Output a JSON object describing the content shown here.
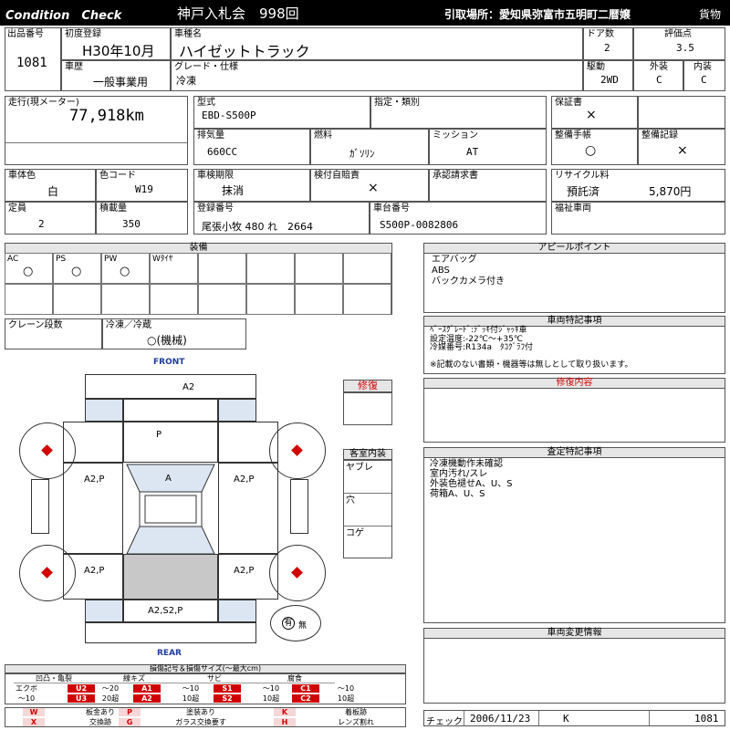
{
  "header": {
    "title_en": "Condition　Check",
    "auction": "神戸入札会　998回",
    "pickup": "引取場所：愛知県弥富市五明町二暦嬢",
    "category": "貨物"
  },
  "row1": {
    "lot_label": "出品番号",
    "lot": "1081",
    "reg_label": "初度登録",
    "reg": "H30年10月",
    "name_label": "車種名",
    "name": "ハイゼットトラック",
    "doors_label": "ドア数",
    "doors": "2",
    "score_label": "評価点",
    "score": "3.5",
    "history_label": "車歴",
    "history": "一般事業用",
    "grade_label": "グレード・仕様",
    "grade": "冷凍",
    "drive_label": "駆動",
    "drive": "2WD",
    "ext_label": "外装",
    "ext": "C",
    "int_label": "内装",
    "int": "C"
  },
  "row2": {
    "mileage_label": "走行(現メーター)",
    "mileage": "77,918km",
    "model_label": "型式",
    "model": "EBD-S500P",
    "designation_label": "指定・類別",
    "warranty_label": "保証書",
    "warranty": "×",
    "disp_label": "排気量",
    "disp": "660CC",
    "fuel_label": "燃料",
    "fuel": "ｶﾞｿﾘﾝ",
    "mission_label": "ミッション",
    "mission": "AT",
    "manual_label": "整備手帳",
    "manual": "○",
    "record_label": "整備記録",
    "record": "×"
  },
  "row3": {
    "color_label": "車体色",
    "color": "白",
    "code_label": "色コード",
    "code": "W19",
    "inspect_label": "車検期限",
    "inspect": "抹消",
    "auto_label": "検付自賠責",
    "auto": "×",
    "approve_label": "承認請求書",
    "recycle_label": "リサイクル料",
    "recycle_status": "預託済",
    "recycle_amount": "5,870円",
    "cap_label": "定員",
    "cap": "2",
    "load_label": "積載量",
    "load": "350",
    "plate_label": "登録番号",
    "plate": "尾張小牧 480 れ　2664",
    "chassis_label": "車台番号",
    "chassis": "S500P-0082806",
    "welfare_label": "福祉車両"
  },
  "equipment": {
    "title": "装備",
    "items": [
      {
        "label": "AC",
        "value": "○"
      },
      {
        "label": "PS",
        "value": "○"
      },
      {
        "label": "PW",
        "value": "○"
      },
      {
        "label": "Wﾀｲﾔ",
        "value": ""
      }
    ]
  },
  "crane": {
    "label": "クレーン段数",
    "freezer_label": "冷凍／冷蔵",
    "freezer": "○(機械)"
  },
  "appeal": {
    "title": "アピールポイント",
    "lines": [
      "エアバッグ",
      "ABS",
      "バックカメラ付き"
    ]
  },
  "notes": {
    "title": "車両特記事項",
    "lines": [
      "ﾍﾞｰｽｸﾞﾚｰﾄﾞ:ﾃﾞｯｷ付ｼﾞｬｯｷ車",
      "設定温度:-22℃～+35℃",
      "冷媒番号:R134a　ﾀｺｸﾞﾗﾌ付",
      "",
      "※記載のない書類・機器等は無しとして取り扱います。"
    ]
  },
  "repair": {
    "label": "修復",
    "detail_title": "修復内容"
  },
  "cabin": {
    "title": "客室内装",
    "items": [
      "ヤブレ",
      "穴",
      "コゲ"
    ]
  },
  "assessment": {
    "title": "査定特記事項",
    "lines": [
      "冷凍機動作未確認",
      "室内汚れ/スレ",
      "外装色褪せA、U、S",
      "荷箱A、U、S"
    ]
  },
  "changes": {
    "title": "車両変更情報"
  },
  "diagram": {
    "front": "FRONT",
    "rear": "REAR",
    "top": "A2",
    "hood": "P",
    "left_front": "A2,P",
    "right_front": "A2,P",
    "windshield": "A",
    "left_rear": "A2,P",
    "right_rear": "A2,P",
    "back": "A2,S2,P",
    "spare": "有",
    "spare_none": "無"
  },
  "legend": {
    "title": "損傷記号＆損傷サイズ(～最大cm)",
    "groups": [
      "凹凸・亀裂",
      "線キズ",
      "サビ",
      "腐食"
    ],
    "row1": [
      "エクボ",
      "U2",
      "～20",
      "A1",
      "～10",
      "S1",
      "～10",
      "C1",
      "～10"
    ],
    "row2": [
      "～10",
      "U3",
      "20超",
      "A2",
      "10超",
      "S2",
      "10超",
      "C2",
      "10超"
    ],
    "row3": [
      "W",
      "板金あり",
      "P",
      "塗装あり",
      "K",
      "着板跡"
    ],
    "row4": [
      "X",
      "交換跡",
      "G",
      "ガラス交換要す",
      "H",
      "レンズ割れ"
    ]
  },
  "footer": {
    "check_label": "チェック",
    "date": "2006/11/23",
    "inspector": "K",
    "lot": "1081"
  }
}
